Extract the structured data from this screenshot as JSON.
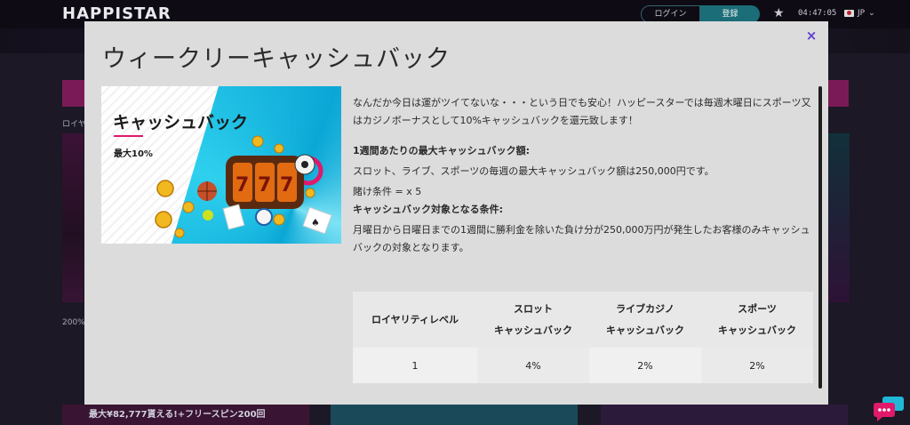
{
  "site": {
    "logo": "HAPPISTAR",
    "login_label": "ログイン",
    "register_label": "登録",
    "clock": "04:47:05",
    "language": "JP",
    "side_text_1": "ロイヤ",
    "side_text_2": "200%",
    "bottom_promo": "最大¥82,777貰える!+フリースピン200回"
  },
  "modal": {
    "title": "ウィークリーキャッシュバック",
    "close_label": "×",
    "banner": {
      "title": "キャッシュバック",
      "subtitle": "最大10%"
    },
    "intro": "なんだか今日は運がツイてないな・・・という日でも安心！ハッピースターでは毎週木曜日にスポーツ又はカジノボーナスとして10%キャッシュバックを還元致します！",
    "section1_heading": "1週間あたりの最大キャッシュバック額:",
    "section1_text": "スロット、ライブ、スポーツの毎週の最大キャッシュバック額は250,000円です。",
    "wager": "賭け条件 = x 5",
    "section2_heading": "キャッシュバック対象となる条件:",
    "section2_text": "月曜日から日曜日までの1週間に勝利金を除いた負け分が250,000万円が発生したお客様のみキャッシュバックの対象となります。",
    "table": {
      "headers": [
        {
          "line1": "ロイヤリティレベル",
          "line2": ""
        },
        {
          "line1": "スロット",
          "line2": "キャッシュバック"
        },
        {
          "line1": "ライブカジノ",
          "line2": "キャッシュバック"
        },
        {
          "line1": "スポーツ",
          "line2": "キャッシュバック"
        }
      ],
      "rows": [
        [
          "1",
          "4%",
          "2%",
          "2%"
        ]
      ]
    }
  },
  "colors": {
    "accent": "#5c3ed1",
    "banner_blue": "#0aa7d6",
    "banner_pink": "#e0196a"
  }
}
